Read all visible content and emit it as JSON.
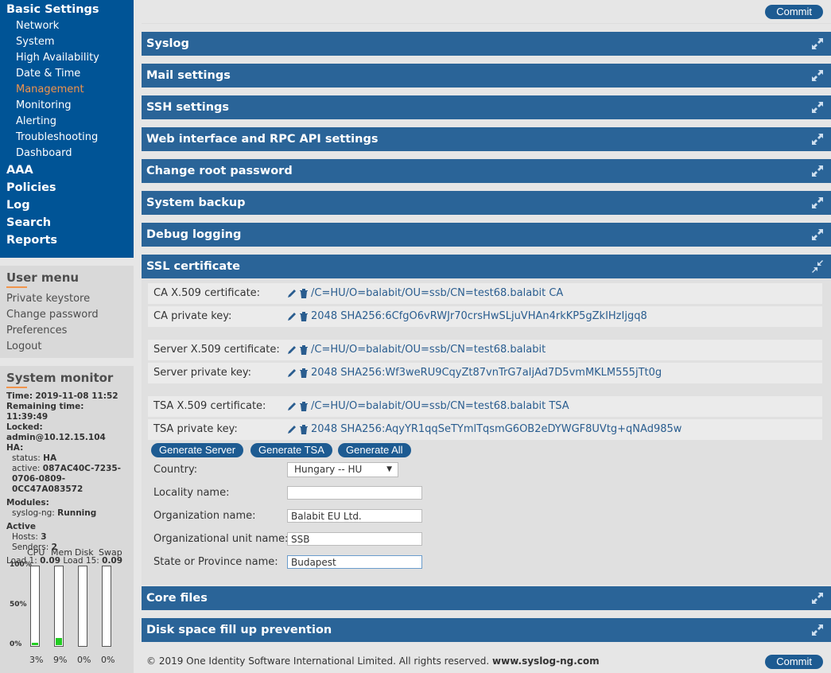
{
  "nav": {
    "basic_settings": "Basic Settings",
    "sub_items": [
      "Network",
      "System",
      "High Availability",
      "Date & Time",
      "Management",
      "Monitoring",
      "Alerting",
      "Troubleshooting",
      "Dashboard"
    ],
    "active_sub": "Management",
    "top_items": [
      "AAA",
      "Policies",
      "Log",
      "Search",
      "Reports"
    ]
  },
  "user_menu": {
    "title": "User menu",
    "items": [
      "Private keystore",
      "Change password",
      "Preferences",
      "Logout"
    ]
  },
  "system_monitor": {
    "title": "System monitor",
    "time_label": "Time:",
    "time": "2019-11-08 11:52",
    "remaining_label": "Remaining time:",
    "remaining": "11:39:49",
    "locked_label": "Locked:",
    "locked": "admin@10.12.15.104",
    "ha_label": "HA:",
    "ha_status_label": "status:",
    "ha_status": "HA",
    "ha_active_label": "active:",
    "ha_active_1": "087AC40C-7235-",
    "ha_active_2": "0706-0809-",
    "ha_active_3": "0CC47A083572",
    "modules_label": "Modules:",
    "module_name": "syslog-ng:",
    "module_state": "Running",
    "active_label": "Active",
    "hosts_label": "Hosts:",
    "hosts": "3",
    "senders_label": "Senders:",
    "senders": "2",
    "load1_label": "Load 1:",
    "load1": "0.09",
    "load15_label": "Load 15:",
    "load15": "0.09",
    "meter_labels": [
      "CPU",
      "Mem",
      "Disk",
      "Swap"
    ],
    "axis_labels": [
      "100%",
      "50%",
      "0%"
    ],
    "meter_values": [
      "3%",
      "9%",
      "0%",
      "0%"
    ],
    "meter_fractions": [
      0.03,
      0.09,
      0,
      0
    ],
    "meter_color": "#22cc22"
  },
  "main": {
    "commit_label": "Commit",
    "panels": [
      "Syslog",
      "Mail settings",
      "SSH settings",
      "Web interface and RPC API settings",
      "Change root password",
      "System backup",
      "Debug logging",
      "SSL certificate",
      "Core files",
      "Disk space fill up prevention"
    ],
    "ssl": {
      "ca_cert_label": "CA X.509 certificate:",
      "ca_cert": "/C=HU/O=balabit/OU=ssb/CN=test68.balabit CA",
      "ca_key_label": "CA private key:",
      "ca_key": "2048 SHA256:6CfgO6vRWJr70crsHwSLjuVHAn4rkKP5gZkIHzIjgq8",
      "server_cert_label": "Server X.509 certificate:",
      "server_cert": "/C=HU/O=balabit/OU=ssb/CN=test68.balabit",
      "server_key_label": "Server private key:",
      "server_key": "2048 SHA256:Wf3weRU9CqyZt87vnTrG7aIjAd7D5vmMKLM555jTt0g",
      "tsa_cert_label": "TSA X.509 certificate:",
      "tsa_cert": "/C=HU/O=balabit/OU=ssb/CN=test68.balabit TSA",
      "tsa_key_label": "TSA private key:",
      "tsa_key": "2048 SHA256:AqyYR1qqSeTYmlTqsmG6OB2eDYWGF8UVtg+qNAd985w",
      "btn_generate_server": "Generate Server",
      "btn_generate_tsa": "Generate TSA",
      "btn_generate_all": "Generate All",
      "country_label": "Country:",
      "country_value": "Hungary -- HU",
      "locality_label": "Locality name:",
      "locality_value": "",
      "org_label": "Organization name:",
      "org_value": "Balabit EU Ltd.",
      "org_unit_label": "Organizational unit name:",
      "org_unit_value": "SSB",
      "state_label": "State or Province name:",
      "state_value": "Budapest"
    },
    "footer_text": "© 2019 One Identity Software International Limited. All rights reserved.",
    "footer_link": "www.syslog-ng.com"
  },
  "colors": {
    "nav_bg": "#005496",
    "panel_bg": "#2a6498",
    "accent": "#f0944c",
    "link": "#2a5d8f"
  }
}
